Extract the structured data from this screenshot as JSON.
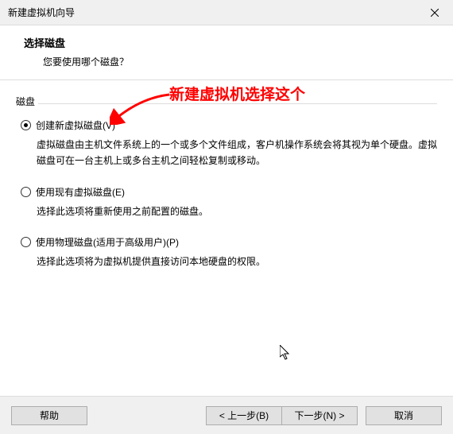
{
  "titlebar": {
    "title": "新建虚拟机向导"
  },
  "header": {
    "title": "选择磁盘",
    "subtitle": "您要使用哪个磁盘？"
  },
  "fieldset": {
    "label": "磁盘"
  },
  "options": [
    {
      "label": "创建新虚拟磁盘(V)",
      "desc": "虚拟磁盘由主机文件系统上的一个或多个文件组成，客户机操作系统会将其视为单个硬盘。虚拟磁盘可在一台主机上或多台主机之间轻松复制或移动。",
      "checked": true
    },
    {
      "label": "使用现有虚拟磁盘(E)",
      "desc": "选择此选项将重新使用之前配置的磁盘。",
      "checked": false
    },
    {
      "label": "使用物理磁盘(适用于高级用户)(P)",
      "desc": "选择此选项将为虚拟机提供直接访问本地硬盘的权限。",
      "checked": false
    }
  ],
  "annotation": {
    "text": "新建虚拟机选择这个"
  },
  "footer": {
    "help": "帮助",
    "back": "< 上一步(B)",
    "next": "下一步(N) >",
    "cancel": "取消"
  }
}
